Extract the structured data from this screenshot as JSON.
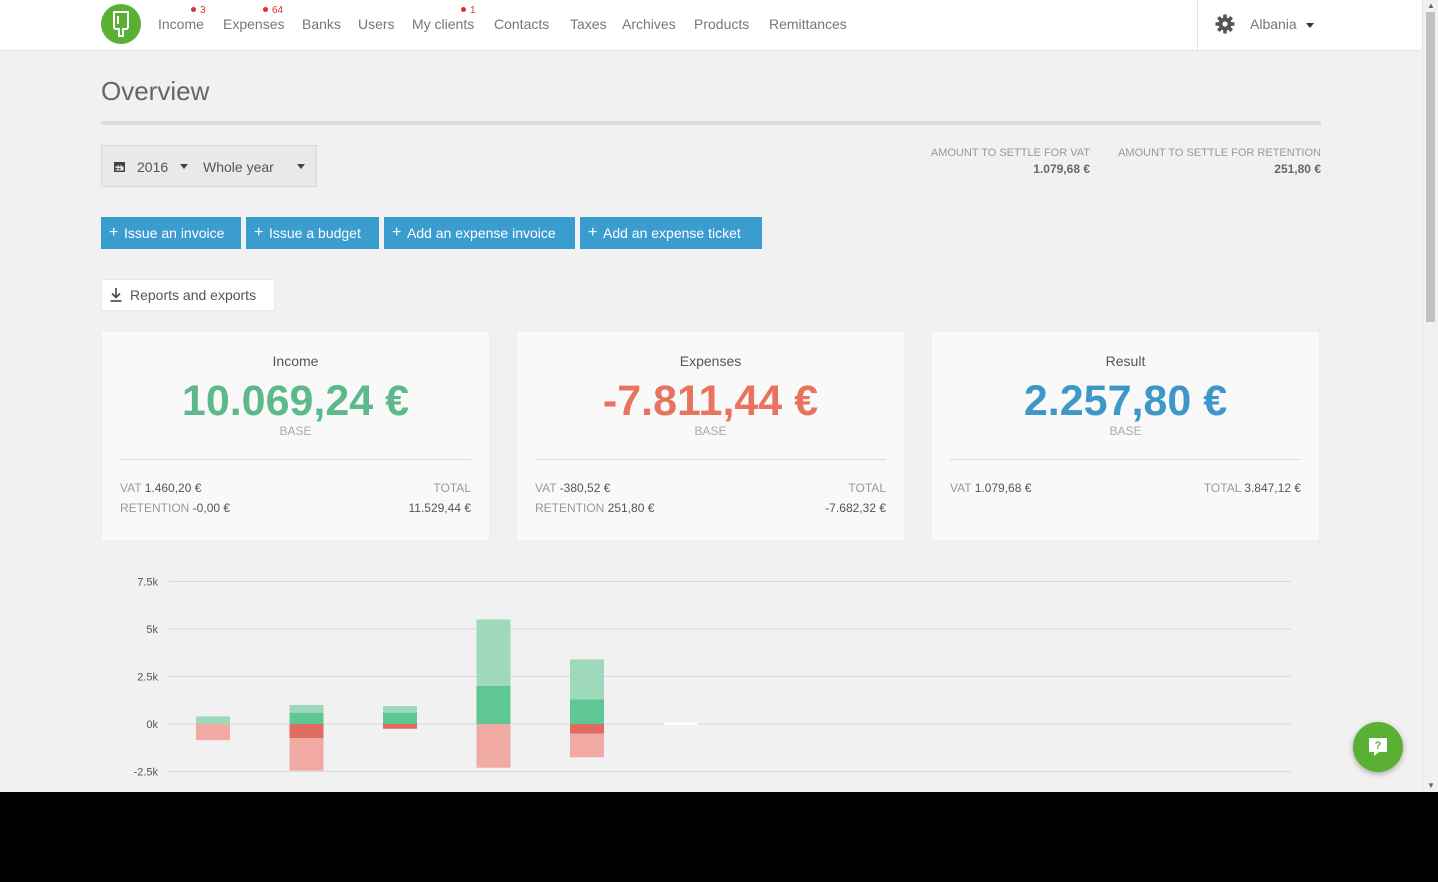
{
  "nav": {
    "items": [
      {
        "label": "Income",
        "badge": "3"
      },
      {
        "label": "Expenses",
        "badge": "64"
      },
      {
        "label": "Banks"
      },
      {
        "label": "Users"
      },
      {
        "label": "My clients",
        "badge": "1"
      },
      {
        "label": "Contacts"
      },
      {
        "label": "Taxes"
      },
      {
        "label": "Archives"
      },
      {
        "label": "Products"
      },
      {
        "label": "Remittances"
      }
    ],
    "country": "Albania",
    "settings_icon": "gear-icon",
    "logo_icon": "popsicle-logo"
  },
  "page": {
    "title": "Overview"
  },
  "period": {
    "year": "2016",
    "range": "Whole year"
  },
  "settle": {
    "vat_label": "AMOUNT TO SETTLE FOR VAT",
    "vat_value": "1.079,68 €",
    "retention_label": "AMOUNT TO SETTLE FOR RETENTION",
    "retention_value": "251,80 €"
  },
  "actions": {
    "issue_invoice": "Issue an invoice",
    "issue_budget": "Issue a budget",
    "add_expense_invoice": "Add an expense invoice",
    "add_expense_ticket": "Add an expense ticket"
  },
  "reports": {
    "label": "Reports and exports"
  },
  "cards": {
    "income": {
      "title": "Income",
      "value": "10.069,24 €",
      "base": "BASE",
      "vat_label": "VAT",
      "vat": "1.460,20 €",
      "retention_label": "RETENTION",
      "retention": "-0,00 €",
      "total_label": "TOTAL",
      "total": "11.529,44 €"
    },
    "expenses": {
      "title": "Expenses",
      "value": "-7.811,44 €",
      "base": "BASE",
      "vat_label": "VAT",
      "vat": "-380,52 €",
      "retention_label": "RETENTION",
      "retention": "251,80 €",
      "total_label": "TOTAL",
      "total": "-7.682,32 €"
    },
    "result": {
      "title": "Result",
      "value": "2.257,80 €",
      "base": "BASE",
      "vat_label": "VAT",
      "vat": "1.079,68 €",
      "total_label": "TOTAL",
      "total": "3.847,12 €"
    }
  },
  "colors": {
    "income": "#5db98a",
    "expenses": "#e8735f",
    "result": "#3f97c8",
    "bar_income_base": "#5ec793",
    "bar_income_extra": "#9fd9bb",
    "bar_expense_base": "#e06b60",
    "bar_expense_extra": "#f0a9a3",
    "action_button": "#3b9dcf",
    "brand": "#5ab033"
  },
  "chart_data": {
    "type": "bar",
    "stacked": true,
    "y_ticks": [
      "7.5k",
      "5k",
      "2.5k",
      "0k",
      "-2.5k"
    ],
    "y_tick_values": [
      7500,
      5000,
      2500,
      0,
      -2500
    ],
    "ylim": [
      -2900,
      7500
    ],
    "grid": true,
    "months": 12,
    "series": [
      {
        "key": "income_base",
        "values": [
          0,
          600,
          600,
          2000,
          1300,
          0,
          0,
          0,
          0,
          0,
          0,
          0
        ]
      },
      {
        "key": "income_extra",
        "values": [
          400,
          400,
          350,
          3500,
          2100,
          0,
          0,
          0,
          0,
          0,
          0,
          0
        ]
      },
      {
        "key": "expense_base",
        "values": [
          0,
          -750,
          -250,
          0,
          -500,
          0,
          0,
          0,
          0,
          0,
          0,
          0
        ]
      },
      {
        "key": "expense_extra",
        "values": [
          -850,
          -1700,
          0,
          -2300,
          -1250,
          0,
          0,
          0,
          0,
          0,
          0,
          0
        ]
      }
    ]
  },
  "help": {
    "icon": "help-chat-icon"
  }
}
